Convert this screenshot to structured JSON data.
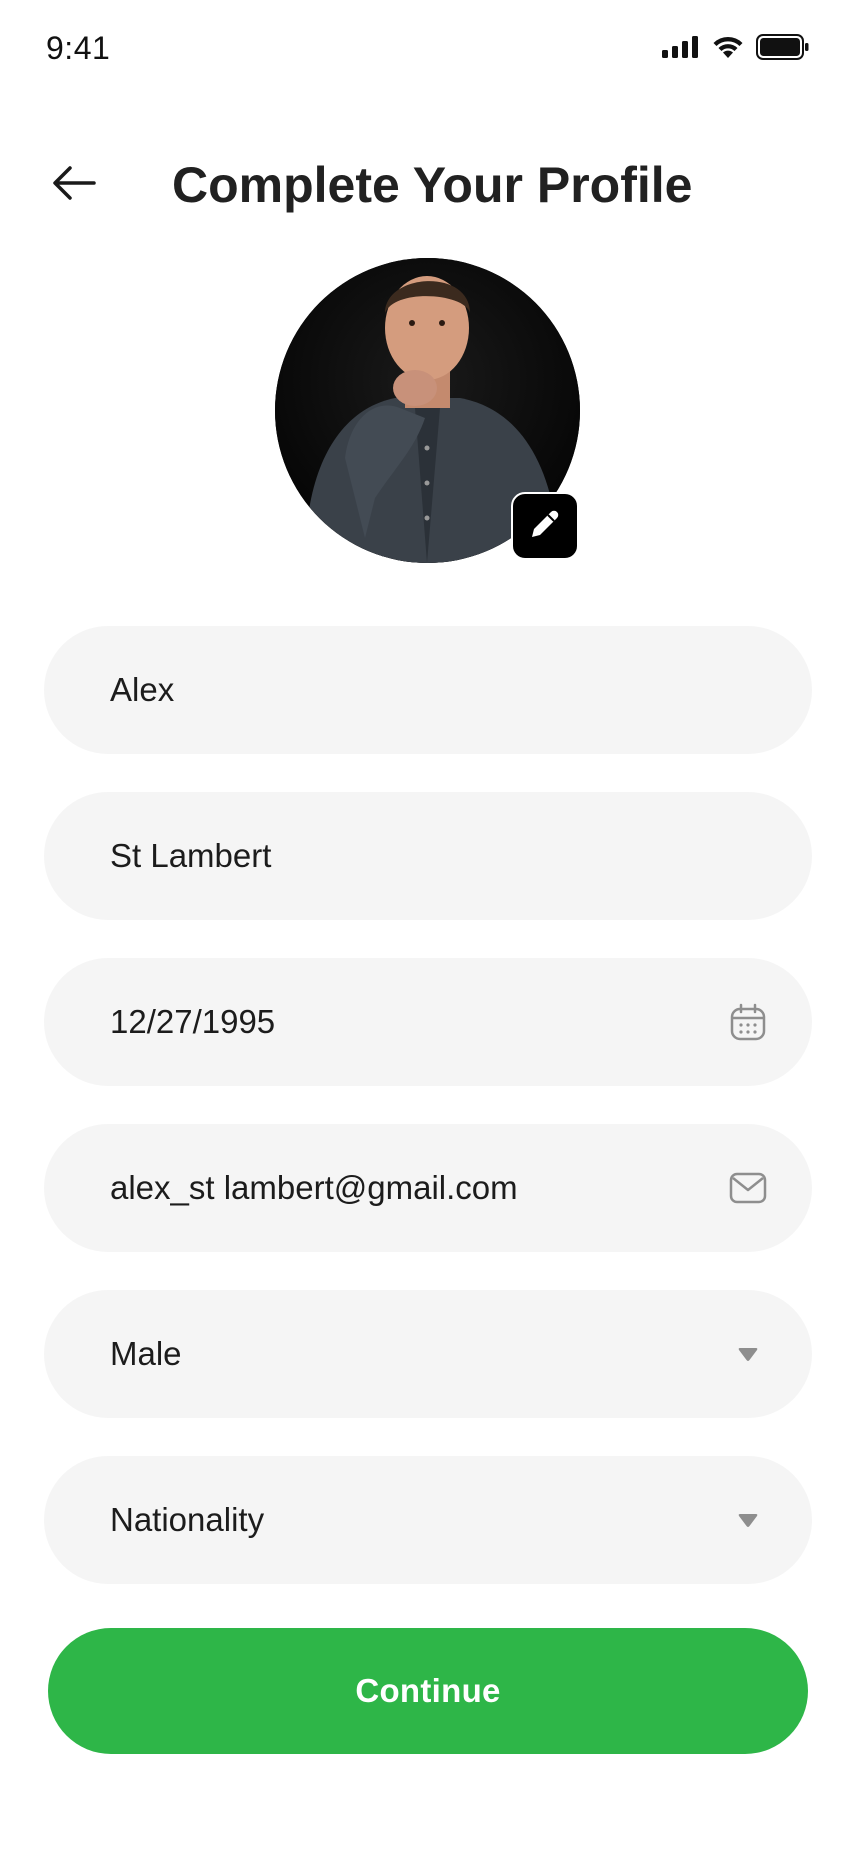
{
  "status_bar": {
    "time": "9:41",
    "icons": [
      "signal-icon",
      "wifi-icon",
      "battery-icon"
    ]
  },
  "header": {
    "title": "Complete Your Profile",
    "back_icon": "arrow-left-icon"
  },
  "avatar": {
    "edit_icon": "pencil-icon"
  },
  "form": {
    "first_name": "Alex",
    "last_name": "St Lambert",
    "date_of_birth": "12/27/1995",
    "email": "alex_st lambert@gmail.com",
    "gender": "Male",
    "nationality": "Nationality"
  },
  "actions": {
    "continue_label": "Continue"
  },
  "colors": {
    "accent": "#2eb648",
    "field_bg": "#f5f5f5",
    "title": "#212121"
  }
}
